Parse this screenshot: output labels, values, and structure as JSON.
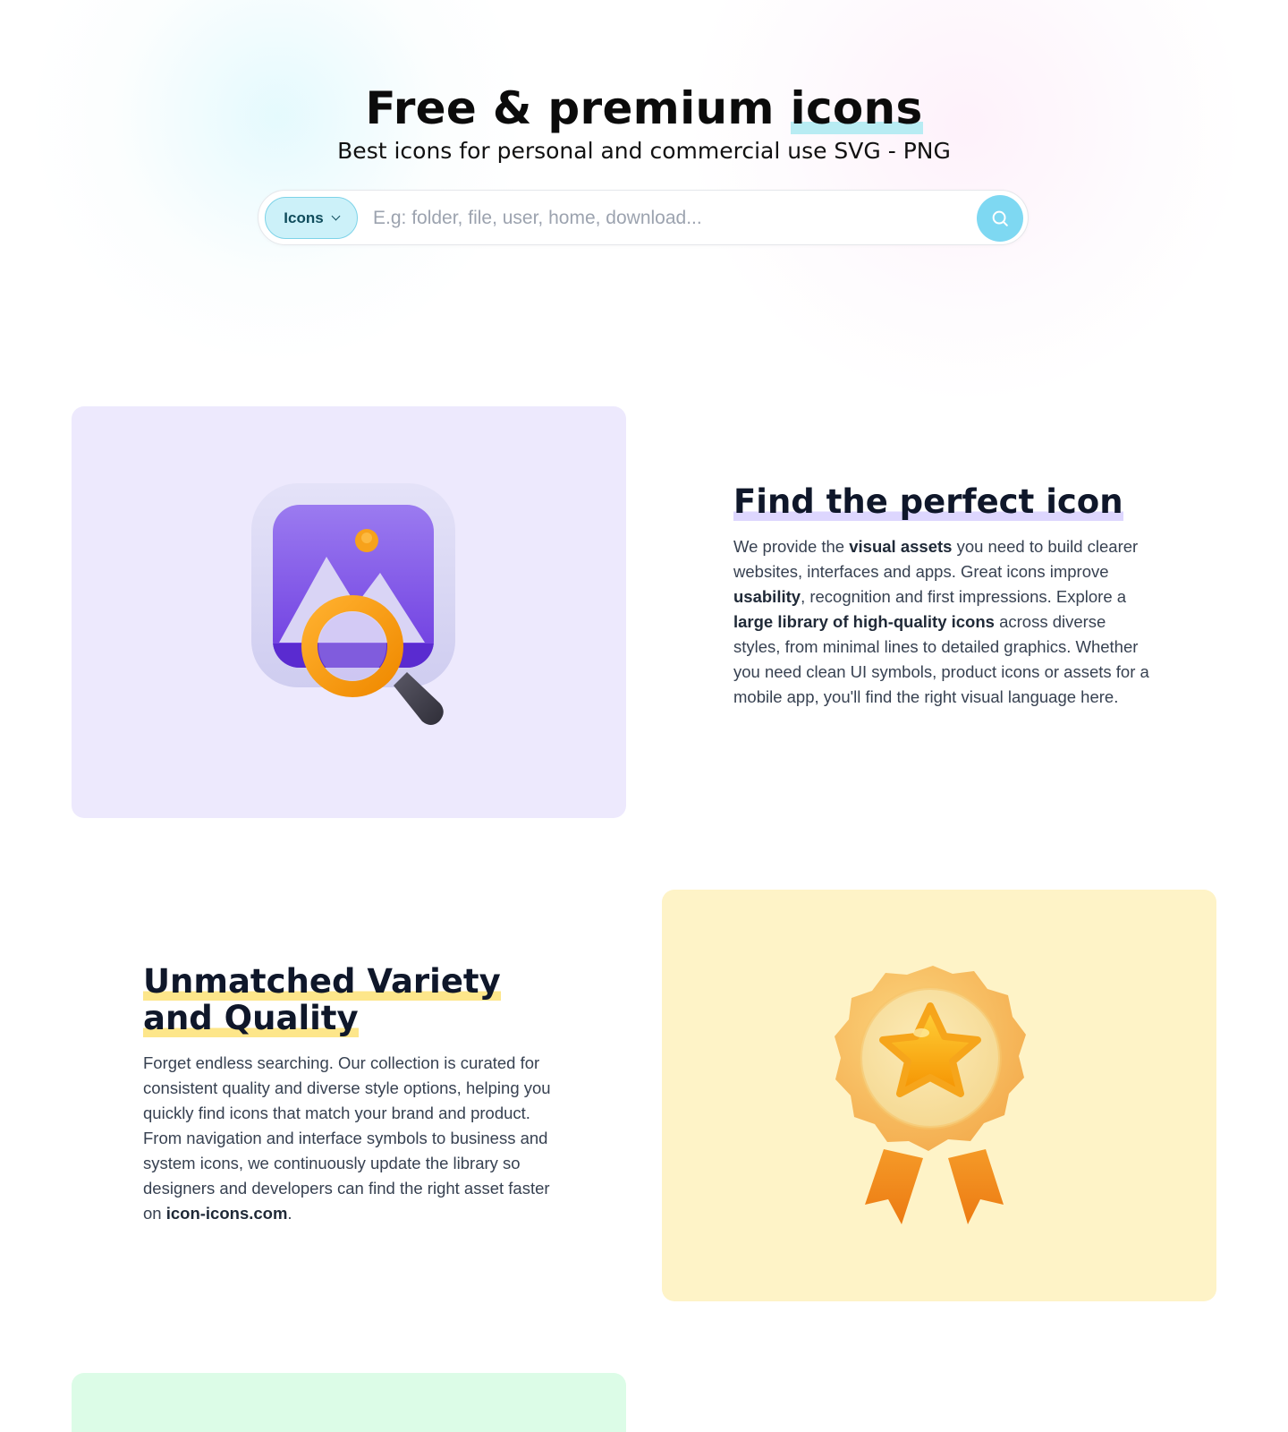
{
  "hero": {
    "title_prefix": "Free & premium ",
    "title_highlight": "icons",
    "subtitle": "Best icons for personal and commercial use SVG - PNG"
  },
  "search": {
    "type_label": "Icons",
    "placeholder": "E.g: folder, file, user, home, download..."
  },
  "features": [
    {
      "title": "Find the perfect icon",
      "body": [
        {
          "t": "We provide the "
        },
        {
          "t": "visual assets",
          "b": true
        },
        {
          "t": " you need to build clearer websites, interfaces and apps. Great icons improve "
        },
        {
          "t": "usability",
          "b": true
        },
        {
          "t": ", recognition and first impressions. Explore a "
        },
        {
          "t": "large library of high-quality icons",
          "b": true
        },
        {
          "t": " across diverse styles, from minimal lines to detailed graphics. Whether you need clean UI symbols, product icons or assets for a mobile app, you'll find the right visual language here."
        }
      ]
    },
    {
      "title": "Unmatched Variety and Quality",
      "body": [
        {
          "t": "Forget endless searching. Our collection is curated for consistent quality and diverse style options, helping you quickly find icons that match your brand and product. From navigation and interface symbols to business and system icons, we continuously update the library so designers and developers can find the right asset faster on "
        },
        {
          "t": "icon-icons.com",
          "b": true
        },
        {
          "t": "."
        }
      ]
    }
  ],
  "illustrations": [
    "image-search-icon",
    "award-badge-icon"
  ],
  "colors": {
    "accent_cyan": "#7ed8f2",
    "card_lavender": "#ede9fd",
    "card_yellow": "#fef3c7",
    "card_green": "#dcfce7"
  }
}
